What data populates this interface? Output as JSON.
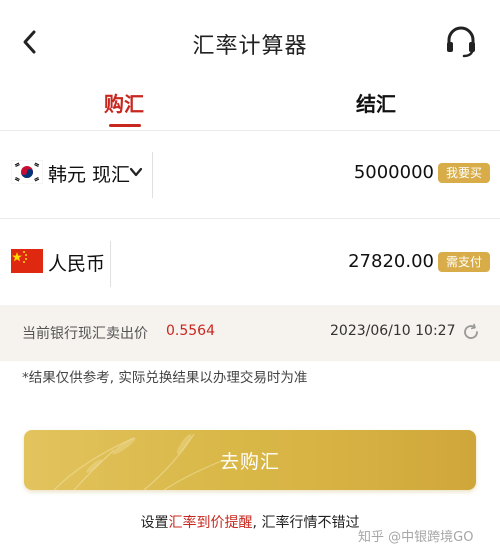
{
  "header": {
    "title": "汇率计算器"
  },
  "tabs": [
    {
      "label": "购汇"
    },
    {
      "label": "结汇"
    }
  ],
  "from": {
    "currency": "韩元 现汇",
    "amount": "5000000",
    "tag": "我要买"
  },
  "to": {
    "currency": "人民币",
    "amount": "27820.00",
    "tag": "需支付"
  },
  "rate": {
    "label": "当前银行现汇卖出价",
    "value": "0.5564",
    "time": "2023/06/10 10:27"
  },
  "note": "*结果仅供参考, 实际兑换结果以办理交易时为准",
  "cta": {
    "label": "去购汇"
  },
  "footer": {
    "prefix": "设置",
    "link": "汇率到价提醒",
    "suffix": ", 汇率行情不错过"
  },
  "watermark": "知乎 @中银跨境GO",
  "colors": {
    "accent": "#c8271f",
    "gold": "#d8ad49",
    "rate_bg": "#f6f2ee"
  }
}
